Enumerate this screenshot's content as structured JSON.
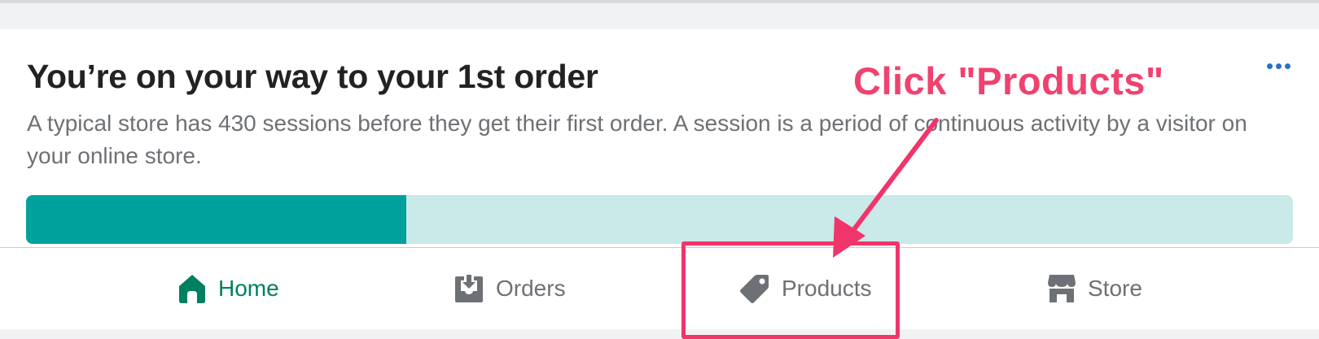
{
  "card": {
    "title": "You’re on your way to your 1st order",
    "description": "A typical store has 430 sessions before they get their first order. A session is a period of continuous activity by a visitor on your online store.",
    "progress_fraction": 0.3,
    "more_icon": "ellipsis-icon"
  },
  "tabs": [
    {
      "label": "Home",
      "icon": "home-icon",
      "active": true
    },
    {
      "label": "Orders",
      "icon": "orders-icon",
      "active": false
    },
    {
      "label": "Products",
      "icon": "tag-icon",
      "active": false
    },
    {
      "label": "Store",
      "icon": "store-icon",
      "active": false
    }
  ],
  "annotation": {
    "text": "Click \"Products\""
  },
  "colors": {
    "accent_green": "#008060",
    "progress_fill": "#00a19d",
    "progress_track": "#c9eae8",
    "annotation_pink": "#f0426f",
    "link_blue": "#2c6ecb"
  }
}
